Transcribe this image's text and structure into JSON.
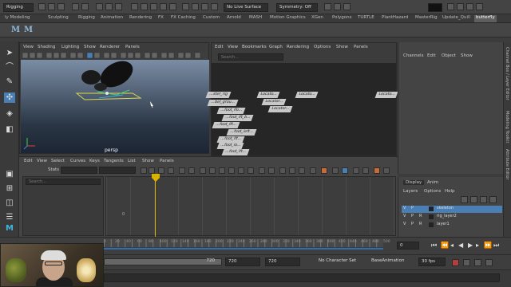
{
  "status_line": {
    "mode_dropdown": "Rigging",
    "live_surface": "No Live Surface",
    "symmetry": "Symmetry: Off",
    "project": "butterfly"
  },
  "shelf_tabs": [
    "ly Modeling",
    "Sculpting",
    "Rigging",
    "Animation",
    "Rendering",
    "FX",
    "FX Caching",
    "Custom",
    "Arnold",
    "MASH",
    "Motion Graphics",
    "XGen",
    "Polygons",
    "TURTLE",
    "PlantHazard",
    "MasterRig",
    "Update_Quill",
    "butterfly"
  ],
  "shelf_icons": [
    "M",
    "M"
  ],
  "viewport": {
    "menus": [
      "View",
      "Shading",
      "Lighting",
      "Show",
      "Renderer",
      "Panels"
    ],
    "camera_label": "persp"
  },
  "node_editor": {
    "menus": [
      "Edit",
      "View",
      "Bookmarks",
      "Graph",
      "Rendering",
      "Options",
      "Show",
      "Panels"
    ],
    "search_placeholder": "Search...",
    "nodes": [
      "...ster_rig",
      "...bel_grou...",
      "...foot_lfo...",
      "...foot_lft_b...",
      "...foot_lft...",
      "...foot_left...",
      "...foot_lft...",
      "...foot_lo...",
      "...foot_lft...",
      "Locato...",
      "Locator...",
      "Locator...",
      "Locato...",
      "Locato..."
    ]
  },
  "channel_box": {
    "menus": [
      "Channels",
      "Edit",
      "Object",
      "Show"
    ]
  },
  "side_tabs": [
    "Channel Box / Layer Editor",
    "Modeling Toolkit",
    "Attribute Editor"
  ],
  "layer_editor": {
    "tabs": [
      "Display",
      "Anim"
    ],
    "menus": [
      "Layers",
      "Options",
      "Help"
    ],
    "layers": [
      {
        "v": "V",
        "p": "P",
        "r": "",
        "name": "skeleton"
      },
      {
        "v": "V",
        "p": "P",
        "r": "R",
        "name": "rig_layer2"
      },
      {
        "v": "V",
        "p": "P",
        "r": "R",
        "name": "layer1"
      }
    ]
  },
  "graph_editor": {
    "menus": [
      "Edit",
      "View",
      "Select",
      "Curves",
      "Keys",
      "Tangents",
      "List",
      "Show",
      "Panels"
    ],
    "stats_label": "Stats",
    "search_placeholder": "Search...",
    "graph_value": "0"
  },
  "time_slider": {
    "ticks": [
      "0",
      "10",
      "20",
      "30",
      "40",
      "50",
      "60",
      "70",
      "80",
      "90",
      "100",
      "110",
      "120",
      "130",
      "140",
      "150",
      "160",
      "170",
      "180",
      "190",
      "200",
      "210",
      "220",
      "230",
      "240",
      "250",
      "260",
      "270",
      "280",
      "290",
      "300",
      "310",
      "320",
      "330",
      "340",
      "350",
      "360",
      "370",
      "380",
      "390",
      "400",
      "410",
      "420",
      "430",
      "440",
      "450",
      "460",
      "470",
      "480",
      "490",
      "500"
    ],
    "current_frame": "0"
  },
  "range_slider": {
    "range_end": "720",
    "anim_end": "720",
    "playback_end": "720",
    "character_set": "No Character Set",
    "anim_layer": "BaseAnimation",
    "fps": "30 fps"
  }
}
